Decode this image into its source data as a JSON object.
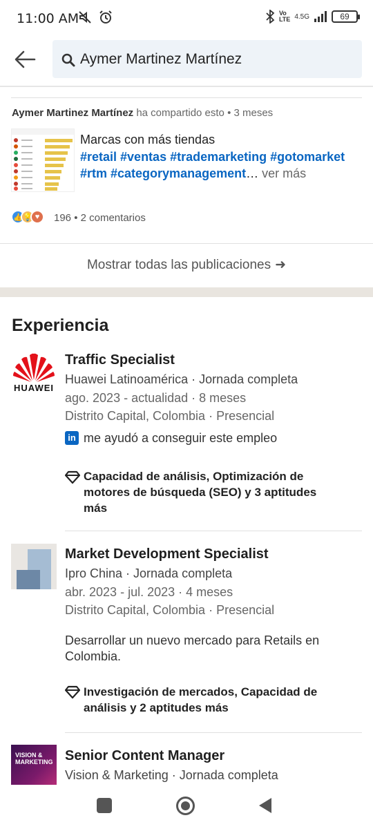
{
  "status_bar": {
    "time": "11:00 AM",
    "network": "4.5G",
    "battery": "69"
  },
  "search": {
    "query": "Aymer Martinez Martínez"
  },
  "post": {
    "author": "Aymer Martinez Martínez",
    "meta": "ha compartido esto • 3 meses",
    "title": "Marcas con más tiendas",
    "hashtags_line1": "#retail #ventas #trademarketing #gotomarket",
    "hashtags_line2": "#rtm #categorymanagement",
    "ellipsis": "…",
    "see_more": "ver más",
    "reaction_count": "196",
    "comments": "• 2 comentarios"
  },
  "show_all_label": "Mostrar todas las publicaciones",
  "experience": {
    "title": "Experiencia",
    "items": [
      {
        "title": "Traffic Specialist",
        "company": "Huawei Latinoamérica · Jornada completa",
        "dates": "ago. 2023 - actualidad · 8 meses",
        "location": "Distrito Capital, Colombia · Presencial",
        "helped": "me ayudó a conseguir este empleo",
        "skills": "Capacidad de análisis, Optimización de motores de búsqueda (SEO) y 3 aptitudes más",
        "logo_text": "HUAWEI"
      },
      {
        "title": "Market Development Specialist",
        "company": "Ipro China · Jornada completa",
        "dates": "abr. 2023 - jul. 2023 · 4 meses",
        "location": "Distrito Capital, Colombia · Presencial",
        "description": "Desarrollar un nuevo mercado para Retails en Colombia.",
        "skills": "Investigación de mercados, Capacidad de análisis y 2 aptitudes más"
      },
      {
        "title": "Senior Content Manager",
        "company": "Vision & Marketing  · Jornada completa",
        "logo_text": "VISION & MARKETING"
      }
    ]
  },
  "colors": {
    "link": "#0a66c2",
    "section_gap": "#e9e5df",
    "search_bg": "#eef3f8",
    "huawei_red": "#e3111a"
  }
}
